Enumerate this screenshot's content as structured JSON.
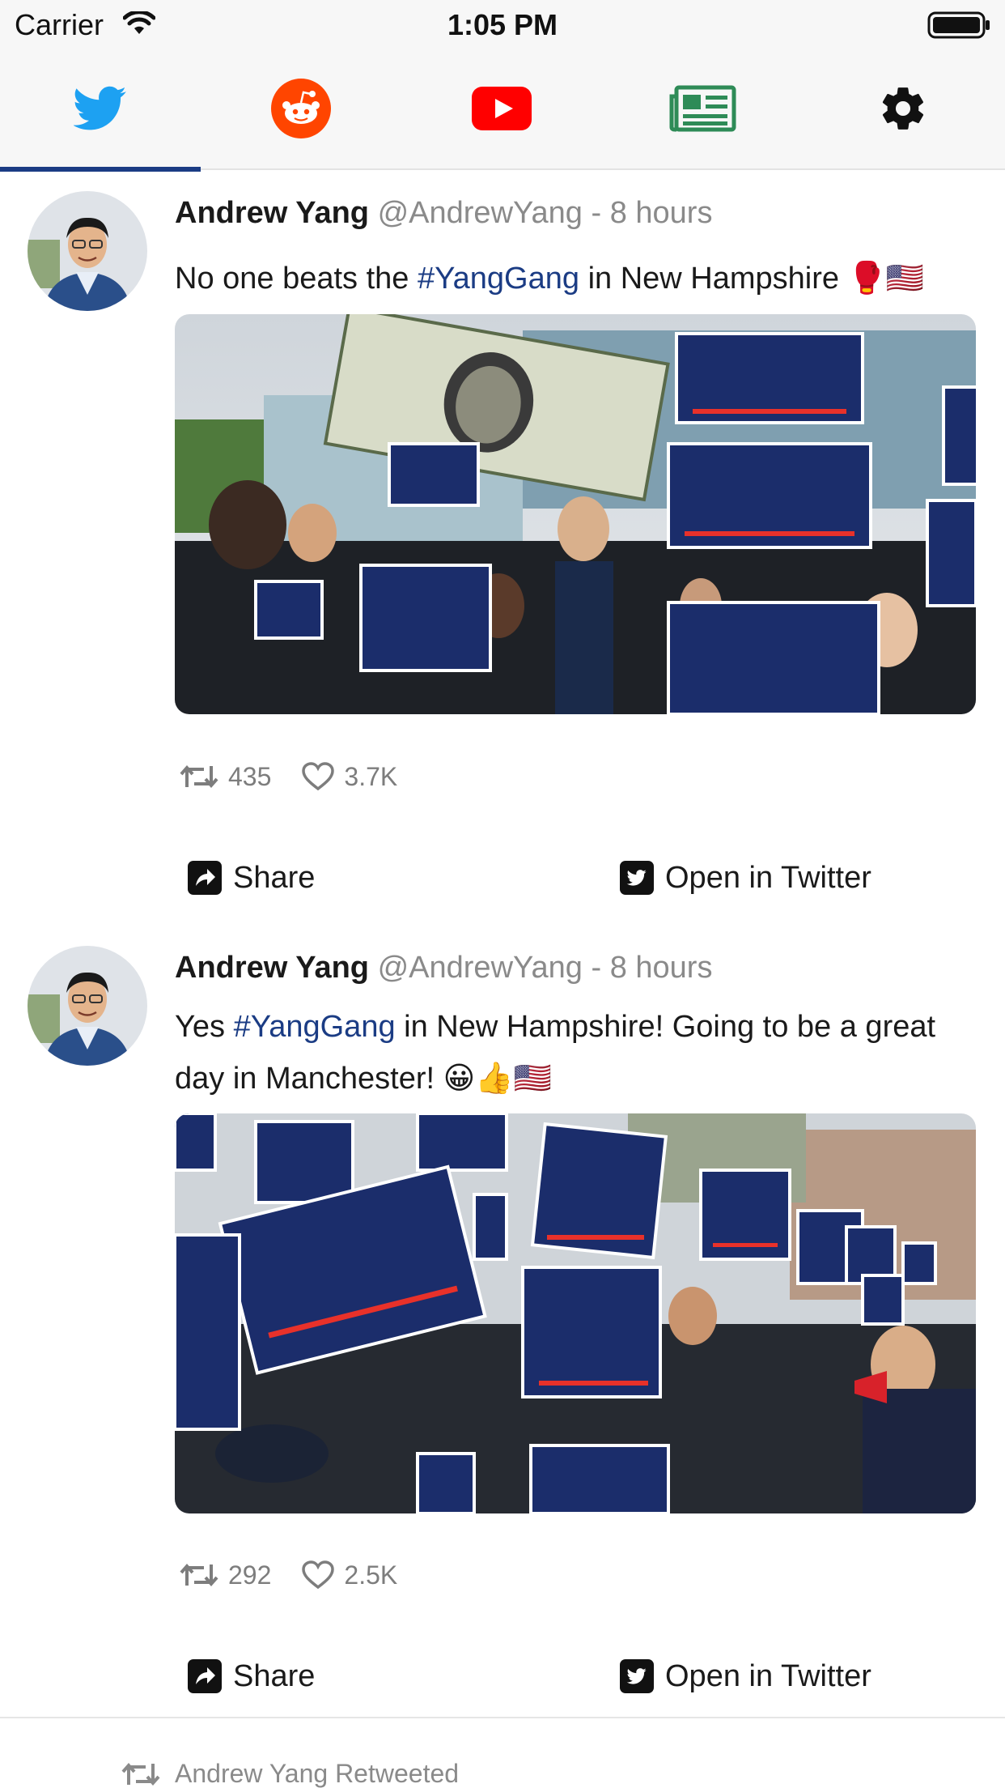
{
  "status_bar": {
    "carrier": "Carrier",
    "time": "1:05 PM"
  },
  "tabs": [
    {
      "icon": "twitter-icon",
      "active": true,
      "color": "#1da1f2"
    },
    {
      "icon": "reddit-icon",
      "active": false,
      "color": "#ff4500"
    },
    {
      "icon": "youtube-icon",
      "active": false,
      "color": "#ff0000"
    },
    {
      "icon": "news-icon",
      "active": false,
      "color": "#2e8b57"
    },
    {
      "icon": "gear-icon",
      "active": false,
      "color": "#111111"
    }
  ],
  "accent_color": "#1b3c84",
  "tweets": [
    {
      "name": "Andrew Yang",
      "meta": "@AndrewYang - 8 hours",
      "text_before": "No one beats the ",
      "hashtag": "#YangGang",
      "text_after": " in New Hampshire 🥊🇺🇸",
      "retweets": "435",
      "likes": "3.7K",
      "share_label": "Share",
      "open_label": "Open in Twitter"
    },
    {
      "name": "Andrew Yang",
      "meta": "@AndrewYang - 8 hours",
      "text_before": "Yes ",
      "hashtag": "#YangGang",
      "text_after": " in New Hampshire!  Going to be a great day in Manchester!  😀👍🇺🇸",
      "retweets": "292",
      "likes": "2.5K",
      "share_label": "Share",
      "open_label": "Open in Twitter"
    }
  ],
  "retweeted_label": "Andrew Yang Retweeted"
}
